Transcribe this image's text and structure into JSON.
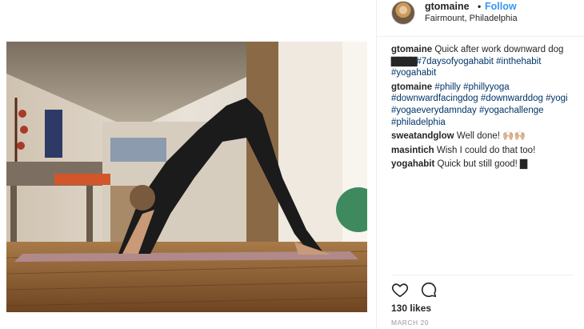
{
  "post": {
    "username": "gtomaine",
    "separator": "•",
    "follow_label": "Follow",
    "location": "Fairmount, Philadelphia"
  },
  "comments": [
    {
      "user": "gtomaine",
      "parts": [
        {
          "text": "Quick after work downward dog ",
          "tag": false
        },
        {
          "text": "▇▇▇▇",
          "tag": false,
          "bars": true
        },
        {
          "text": "#7daysofyogahabit",
          "tag": true
        },
        {
          "text": " ",
          "tag": false
        },
        {
          "text": "#inthehabit",
          "tag": true
        },
        {
          "text": " ",
          "tag": false
        },
        {
          "text": "#yogahabit",
          "tag": true
        }
      ]
    },
    {
      "user": "gtomaine",
      "parts": [
        {
          "text": "#philly",
          "tag": true
        },
        {
          "text": " ",
          "tag": false
        },
        {
          "text": "#phillyyoga",
          "tag": true
        },
        {
          "text": " ",
          "tag": false
        },
        {
          "text": "#downwardfacingdog",
          "tag": true
        },
        {
          "text": " ",
          "tag": false
        },
        {
          "text": "#downwarddog",
          "tag": true
        },
        {
          "text": " ",
          "tag": false
        },
        {
          "text": "#yogi",
          "tag": true
        },
        {
          "text": " ",
          "tag": false
        },
        {
          "text": "#yogaeverydamnday",
          "tag": true
        },
        {
          "text": " ",
          "tag": false
        },
        {
          "text": "#yogachallenge",
          "tag": true
        },
        {
          "text": " ",
          "tag": false
        },
        {
          "text": "#philadelphia",
          "tag": true
        }
      ]
    },
    {
      "user": "sweatandglow",
      "parts": [
        {
          "text": "Well done! 🙌🏼🙌🏼",
          "tag": false
        }
      ]
    },
    {
      "user": "masintich",
      "parts": [
        {
          "text": "Wish I could do that too!",
          "tag": false
        }
      ]
    },
    {
      "user": "yogahabit",
      "parts": [
        {
          "text": "Quick but still good! ",
          "tag": false
        },
        {
          "text": "▇",
          "tag": false,
          "bars": true
        }
      ]
    }
  ],
  "footer": {
    "likes": "130 likes",
    "date": "MARCH 20"
  },
  "icons": {
    "like": "heart-icon",
    "comment": "comment-icon"
  },
  "colors": {
    "link": "#003569",
    "follow": "#3897f0",
    "text": "#262626",
    "muted": "#999999"
  }
}
